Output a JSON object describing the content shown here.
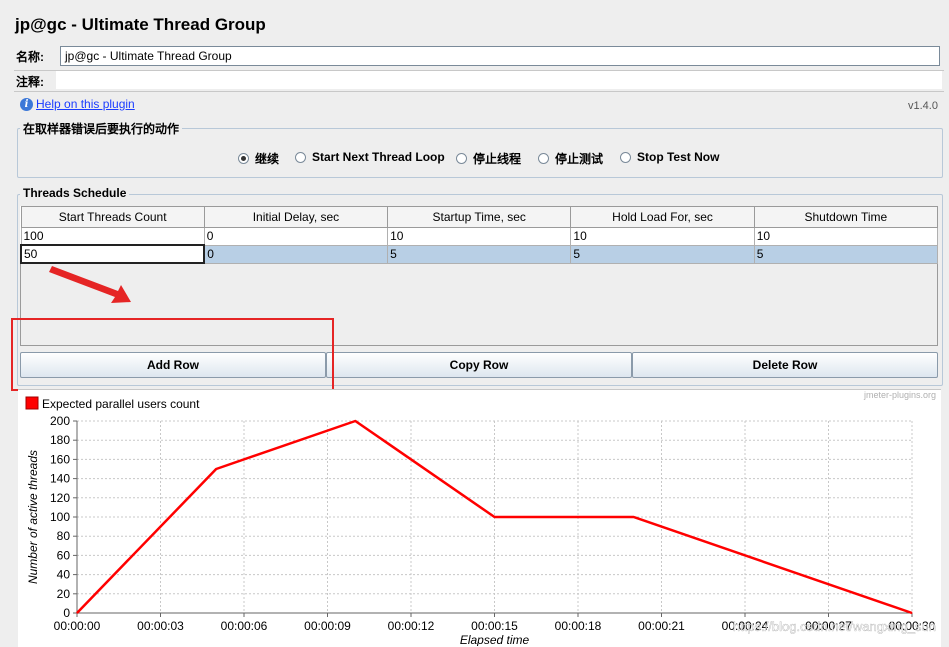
{
  "window": {
    "title": "jp@gc - Ultimate Thread Group"
  },
  "form": {
    "name_label": "名称:",
    "name_value": "jp@gc - Ultimate Thread Group",
    "comment_label": "注释:",
    "comment_value": "",
    "help_link": "Help on this plugin",
    "version": "v1.4.0"
  },
  "error_action": {
    "legend": "在取样器错误后要执行的动作",
    "options": [
      {
        "label": "继续",
        "selected": true
      },
      {
        "label": "Start Next Thread Loop",
        "selected": false
      },
      {
        "label": "停止线程",
        "selected": false
      },
      {
        "label": "停止测试",
        "selected": false
      },
      {
        "label": "Stop Test Now",
        "selected": false
      }
    ]
  },
  "schedule": {
    "legend": "Threads Schedule",
    "columns": [
      "Start Threads Count",
      "Initial Delay, sec",
      "Startup Time, sec",
      "Hold Load For, sec",
      "Shutdown Time"
    ],
    "rows": [
      [
        "100",
        "0",
        "10",
        "10",
        "10"
      ],
      [
        "50",
        "0",
        "5",
        "5",
        "5"
      ]
    ],
    "buttons": {
      "add": "Add Row",
      "copy": "Copy Row",
      "delete": "Delete Row"
    }
  },
  "chart_data": {
    "type": "line",
    "watermark": "jmeter-plugins.org",
    "xlabel": "Elapsed time",
    "ylabel": "Number of active threads",
    "series": [
      {
        "name": "Expected parallel users count",
        "color": "#ff0000",
        "points": [
          [
            0,
            0
          ],
          [
            5,
            150
          ],
          [
            10,
            200
          ],
          [
            15,
            100
          ],
          [
            20,
            100
          ],
          [
            30,
            0
          ]
        ]
      }
    ],
    "xlim": [
      0,
      30
    ],
    "ylim": [
      0,
      200
    ],
    "x_ticks": [
      {
        "v": 0,
        "label": "00:00:00"
      },
      {
        "v": 3,
        "label": "00:00:03"
      },
      {
        "v": 6,
        "label": "00:00:06"
      },
      {
        "v": 9,
        "label": "00:00:09"
      },
      {
        "v": 12,
        "label": "00:00:12"
      },
      {
        "v": 15,
        "label": "00:00:15"
      },
      {
        "v": 18,
        "label": "00:00:18"
      },
      {
        "v": 21,
        "label": "00:00:21"
      },
      {
        "v": 24,
        "label": "00:00:24"
      },
      {
        "v": 27,
        "label": "00:00:27"
      },
      {
        "v": 30,
        "label": "00:00:30"
      }
    ],
    "y_ticks": [
      0,
      20,
      40,
      60,
      80,
      100,
      120,
      140,
      160,
      180,
      200
    ],
    "grid": true,
    "legend_position": "top-left"
  },
  "overlay": {
    "watermark_text": "https://blog.csdn.net/wangxing_sun",
    "annotation_color": "#e52525"
  }
}
